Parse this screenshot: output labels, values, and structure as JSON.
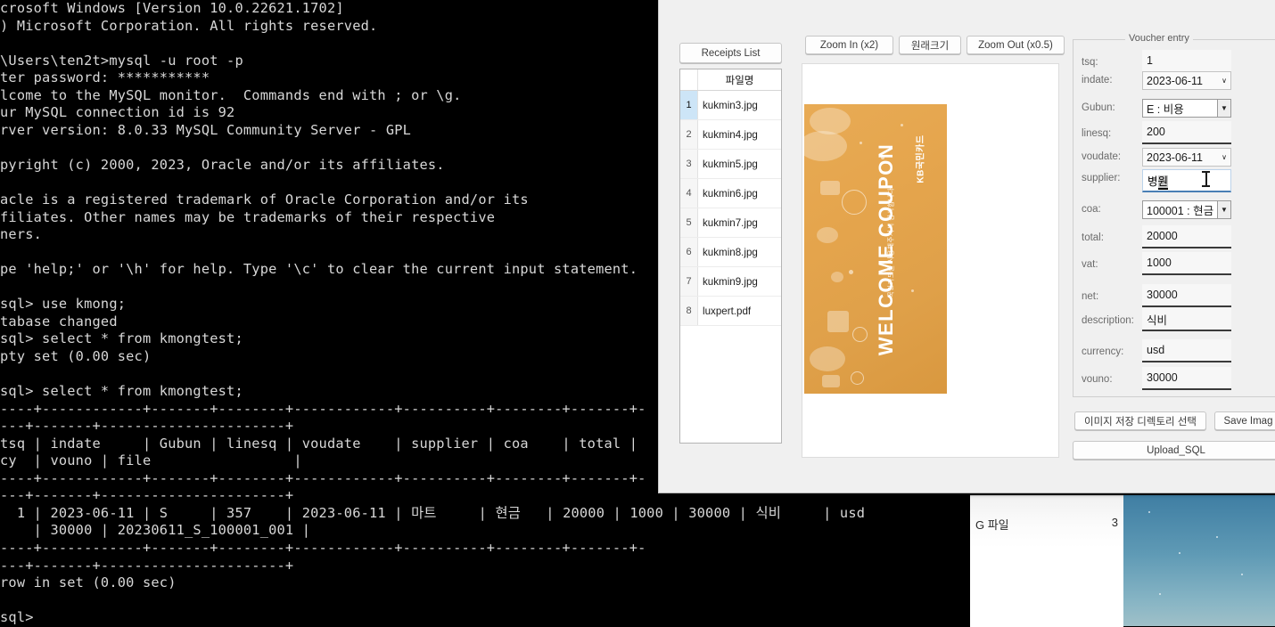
{
  "terminal": {
    "lines": [
      "crosoft Windows [Version 10.0.22621.1702]",
      ") Microsoft Corporation. All rights reserved.",
      "",
      "\\Users\\ten2t>mysql -u root -p",
      "ter password: ***********",
      "lcome to the MySQL monitor.  Commands end with ; or \\g.",
      "ur MySQL connection id is 92",
      "rver version: 8.0.33 MySQL Community Server - GPL",
      "",
      "pyright (c) 2000, 2023, Oracle and/or its affiliates.",
      "",
      "acle is a registered trademark of Oracle Corporation and/or its",
      "filiates. Other names may be trademarks of their respective",
      "ners.",
      "",
      "pe 'help;' or '\\h' for help. Type '\\c' to clear the current input statement.",
      "",
      "sql> use kmong;",
      "tabase changed",
      "sql> select * from kmongtest;",
      "pty set (0.00 sec)",
      "",
      "sql> select * from kmongtest;",
      "----+------------+-------+--------+------------+----------+--------+-------+-",
      "---+-------+----------------------+",
      "tsq | indate     | Gubun | linesq | voudate    | supplier | coa    | total |",
      "cy  | vouno | file                 |",
      "----+------------+-------+--------+------------+----------+--------+-------+-",
      "---+-------+----------------------+",
      "  1 | 2023-06-11 | S     | 357    | 2023-06-11 | 마트     | 현금   | 20000 | 1000 | 30000 | 식비     | usd",
      "    | 30000 | 20230611_S_100001_001 |",
      "----+------------+-------+--------+------------+----------+--------+-------+-",
      "---+-------+----------------------+",
      "row in set (0.00 sec)",
      "",
      "sql>"
    ]
  },
  "app": {
    "file_panel": {
      "receipts_button": "Receipts List",
      "column_header_index": "",
      "column_header_name": "파일명",
      "rows": [
        {
          "index": "1",
          "name": "kukmin3.jpg"
        },
        {
          "index": "2",
          "name": "kukmin4.jpg"
        },
        {
          "index": "3",
          "name": "kukmin5.jpg"
        },
        {
          "index": "4",
          "name": "kukmin6.jpg"
        },
        {
          "index": "5",
          "name": "kukmin7.jpg"
        },
        {
          "index": "6",
          "name": "kukmin8.jpg"
        },
        {
          "index": "7",
          "name": "kukmin9.jpg"
        },
        {
          "index": "8",
          "name": "luxpert.pdf"
        }
      ]
    },
    "viewer": {
      "zoom_in_label": "Zoom In (x2)",
      "zoom_original_label": "원래크기",
      "zoom_out_label": "Zoom Out (x0.5)",
      "image": {
        "title": "WELCOME COUPON",
        "subtitle": "국민카드를 사용해주셔서 감사합니다",
        "brand": "KB국민카드"
      }
    },
    "voucher_form": {
      "legend": "Voucher entry",
      "fields": [
        {
          "label": "tsq:",
          "value": "1"
        },
        {
          "label": "indate:",
          "value": "2023-06-11"
        },
        {
          "label": "Gubun:",
          "value": "E : 비용"
        },
        {
          "label": "linesq:",
          "value": "200"
        },
        {
          "label": "voudate:",
          "value": "2023-06-11"
        },
        {
          "label": "supplier:",
          "value": "병원"
        },
        {
          "label": "coa:",
          "value": "100001 : 현금"
        },
        {
          "label": "total:",
          "value": "20000"
        },
        {
          "label": "vat:",
          "value": "1000"
        },
        {
          "label": "net:",
          "value": "30000"
        },
        {
          "label": "description:",
          "value": "식비"
        },
        {
          "label": "currency:",
          "value": "usd"
        },
        {
          "label": "vouno:",
          "value": "30000"
        }
      ],
      "buttons": {
        "select_dir": "이미지 저장 디렉토리 선택",
        "save_image": "Save Imag",
        "upload_sql": "Upload_SQL"
      }
    }
  },
  "background": {
    "explorer_label": "G 파일",
    "explorer_size": "3"
  },
  "colors": {
    "selection": "#cde5f7",
    "coupon": "#e3a44d",
    "window_chrome": "#f0f0f0"
  }
}
